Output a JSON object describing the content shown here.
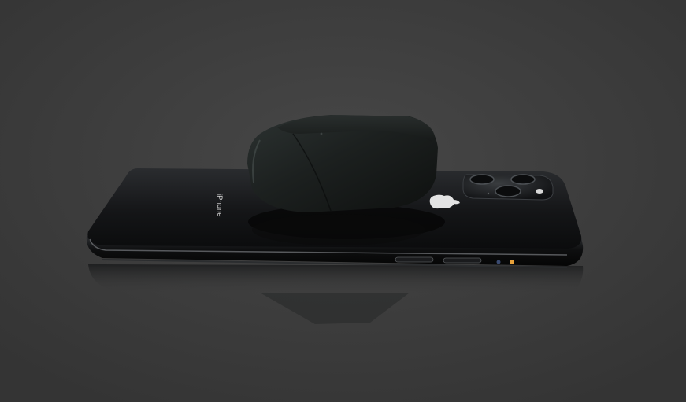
{
  "image": {
    "phone_back_text": "iPhone",
    "colors": {
      "background": "#3d3d3d",
      "phone_body": "#121315",
      "case_body": "#1f2322",
      "flash": "#e7a13a"
    }
  }
}
